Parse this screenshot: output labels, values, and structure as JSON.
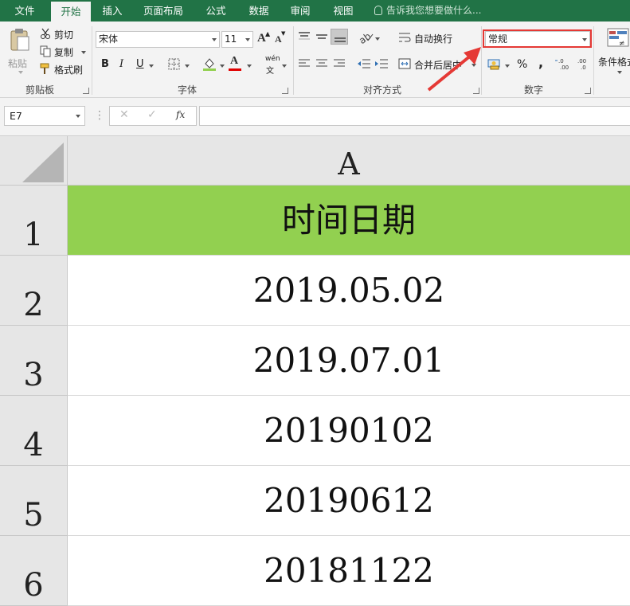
{
  "tabs": [
    "文件",
    "开始",
    "插入",
    "页面布局",
    "公式",
    "数据",
    "审阅",
    "视图"
  ],
  "tell_me": "告诉我您想要做什么...",
  "clipboard": {
    "paste": "粘贴",
    "cut": "剪切",
    "copy": "复制",
    "format_painter": "格式刷",
    "label": "剪贴板"
  },
  "font": {
    "name": "宋体",
    "size": "11",
    "bold": "B",
    "italic": "I",
    "underline": "U",
    "grow": "A",
    "shrink": "A",
    "font_color": "A",
    "phonetic": "wén",
    "label": "字体"
  },
  "alignment": {
    "wrap": "自动换行",
    "merge": "合并后居中",
    "label": "对齐方式"
  },
  "number": {
    "format": "常规",
    "percent": "%",
    "comma": ",",
    "label": "数字"
  },
  "styles": {
    "conditional": "条件格式"
  },
  "namebox": "E7",
  "formula_bar": {
    "cancel": "✕",
    "enter": "✓",
    "fx": "fx"
  },
  "grid": {
    "column": "A",
    "rows": [
      {
        "num": "1",
        "value": "时间日期"
      },
      {
        "num": "2",
        "value": "2019.05.02"
      },
      {
        "num": "3",
        "value": "2019.07.01"
      },
      {
        "num": "4",
        "value": "20190102"
      },
      {
        "num": "5",
        "value": "20190612"
      },
      {
        "num": "6",
        "value": "20181122"
      }
    ]
  },
  "colors": {
    "ribbon_green": "#217346",
    "header_fill": "#92d050",
    "highlight": "#e53935"
  }
}
